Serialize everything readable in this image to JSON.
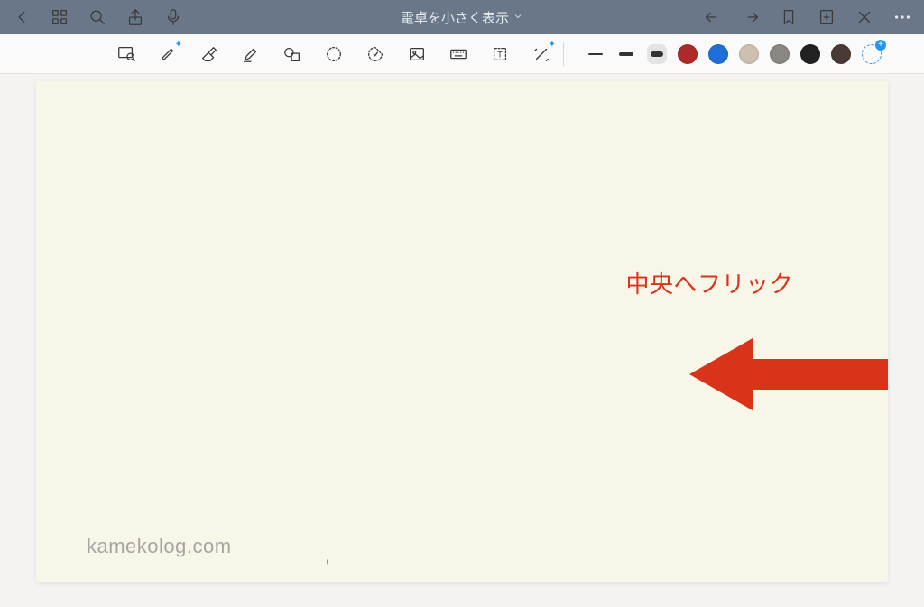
{
  "titlebar": {
    "title": "電卓を小さく表示"
  },
  "annotation": {
    "text": "中央へフリック"
  },
  "watermark": "kamekolog.com",
  "colors": {
    "swatch1": "#b02929",
    "swatch2": "#1f6fd8",
    "swatch3": "#cdbfb2",
    "swatch4": "#8a8680",
    "swatch5": "#222222",
    "swatch6": "#4a3a34"
  },
  "strokes": {
    "thin": 2,
    "medium": 4,
    "thick": 6
  }
}
